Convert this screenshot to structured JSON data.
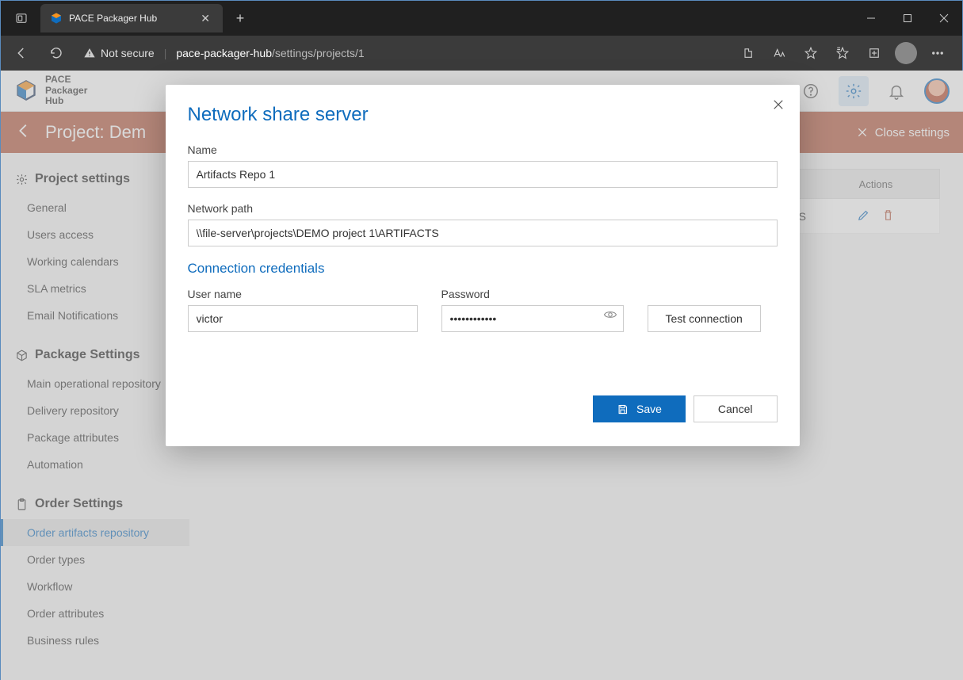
{
  "browser": {
    "tab_title": "PACE Packager Hub",
    "not_secure_label": "Not secure",
    "url_host": "pace-packager-hub",
    "url_path": "/settings/projects/1"
  },
  "app_header": {
    "logo_line1": "PACE",
    "logo_line2": "Packager",
    "logo_line3": "Hub"
  },
  "project_bar": {
    "title": "Project: Dem",
    "close_label": "Close settings"
  },
  "sidebar": {
    "group1_title": "Project settings",
    "group1_items": [
      "General",
      "Users access",
      "Working calendars",
      "SLA metrics",
      "Email Notifications"
    ],
    "group2_title": "Package Settings",
    "group2_items": [
      "Main operational repository",
      "Delivery repository",
      "Package attributes",
      "Automation"
    ],
    "group3_title": "Order Settings",
    "group3_items": [
      "Order artifacts repository",
      "Order types",
      "Workflow",
      "Order attributes",
      "Business rules"
    ],
    "active_item": "Order artifacts repository"
  },
  "table": {
    "header_actions": "Actions",
    "row1_name_tail": "FACTS"
  },
  "modal": {
    "title": "Network share server",
    "name_label": "Name",
    "name_value": "Artifacts Repo 1",
    "path_label": "Network path",
    "path_value": "\\\\file-server\\projects\\DEMO project 1\\ARTIFACTS",
    "cred_title": "Connection credentials",
    "user_label": "User name",
    "user_value": "victor",
    "pw_label": "Password",
    "pw_value": "••••••••••••",
    "test_label": "Test connection",
    "save_label": "Save",
    "cancel_label": "Cancel"
  }
}
